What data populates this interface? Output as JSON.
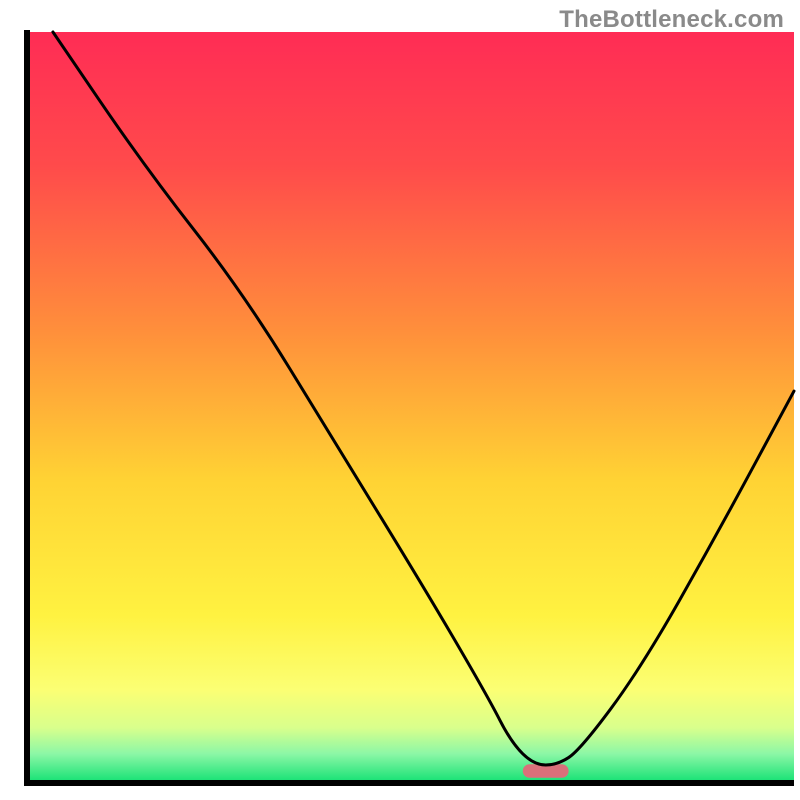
{
  "watermark": "TheBottleneck.com",
  "chart_data": {
    "type": "line",
    "title": "",
    "xlabel": "",
    "ylabel": "",
    "xlim": [
      0,
      100
    ],
    "ylim": [
      0,
      100
    ],
    "series": [
      {
        "name": "curve",
        "x": [
          3,
          15,
          28,
          40,
          52,
          60,
          63,
          66,
          69,
          72,
          80,
          90,
          100
        ],
        "y": [
          100,
          82,
          65,
          45,
          25,
          11,
          5,
          2,
          2,
          4,
          15,
          33,
          52
        ]
      }
    ],
    "marker": {
      "x_center": 67.5,
      "y": 1.2,
      "width": 6,
      "height": 1.8,
      "color": "#d9707a"
    },
    "frame": {
      "stroke": "#000000",
      "stroke_width": 6
    },
    "gradient_stops": [
      {
        "offset": 0.0,
        "color": "#ff2c55"
      },
      {
        "offset": 0.18,
        "color": "#ff4b4b"
      },
      {
        "offset": 0.4,
        "color": "#ff8f3b"
      },
      {
        "offset": 0.6,
        "color": "#ffd334"
      },
      {
        "offset": 0.78,
        "color": "#fff241"
      },
      {
        "offset": 0.88,
        "color": "#fbff74"
      },
      {
        "offset": 0.93,
        "color": "#d9ff8c"
      },
      {
        "offset": 0.965,
        "color": "#8cf7a6"
      },
      {
        "offset": 1.0,
        "color": "#1ee378"
      }
    ]
  }
}
